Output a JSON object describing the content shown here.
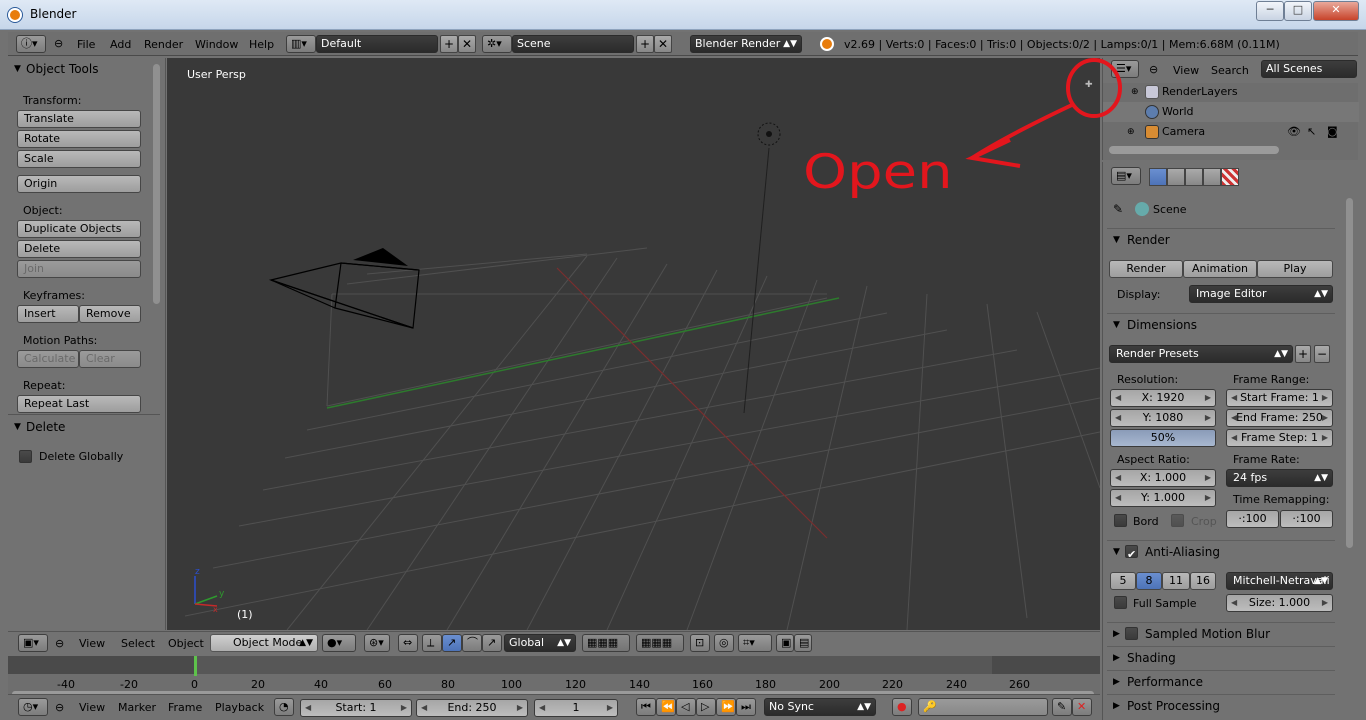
{
  "window": {
    "title": "Blender",
    "min": "─",
    "max": "□",
    "close": "✕"
  },
  "info": {
    "menus": [
      "File",
      "Add",
      "Render",
      "Window",
      "Help"
    ],
    "screen": "Default",
    "scene": "Scene",
    "engine": "Blender Render",
    "stats": "v2.69 | Verts:0 | Faces:0 | Tris:0 | Objects:0/2 | Lamps:0/1 | Mem:6.68M (0.11M)"
  },
  "toolshelf": {
    "title": "Object Tools",
    "transform_label": "Transform:",
    "translate": "Translate",
    "rotate": "Rotate",
    "scale": "Scale",
    "origin": "Origin",
    "object_label": "Object:",
    "duplicate": "Duplicate Objects",
    "delete": "Delete",
    "join": "Join",
    "keyframes_label": "Keyframes:",
    "insert": "Insert",
    "remove": "Remove",
    "motion_label": "Motion Paths:",
    "calculate": "Calculate",
    "clear": "Clear",
    "repeat_label": "Repeat:",
    "repeat_last": "Repeat Last",
    "op_title": "Delete",
    "delete_globally": "Delete Globally"
  },
  "viewport": {
    "label": "User Persp",
    "frame": "(1)"
  },
  "annotation": {
    "text": "Open"
  },
  "view3d_header": {
    "menus": [
      "View",
      "Select",
      "Object"
    ],
    "mode": "Object Mode",
    "orientation": "Global"
  },
  "timeline": {
    "ticks": [
      "-40",
      "-20",
      "0",
      "20",
      "40",
      "60",
      "80",
      "100",
      "120",
      "140",
      "160",
      "180",
      "200",
      "220",
      "240",
      "260"
    ],
    "menus": [
      "View",
      "Marker",
      "Frame",
      "Playback"
    ],
    "start": "Start: 1",
    "end": "End: 250",
    "current": "1",
    "sync": "No Sync"
  },
  "outliner": {
    "menus": [
      "View",
      "Search"
    ],
    "display": "All Scenes",
    "rows": [
      "RenderLayers",
      "World",
      "Camera"
    ]
  },
  "properties": {
    "context": "Scene",
    "render_title": "Render",
    "render_btn": "Render",
    "animation_btn": "Animation",
    "play_btn": "Play",
    "display_label": "Display:",
    "display_value": "Image Editor",
    "dimensions_title": "Dimensions",
    "render_presets": "Render Presets",
    "resolution_label": "Resolution:",
    "res_x": "X: 1920",
    "res_y": "Y: 1080",
    "res_pct": "50%",
    "frame_range_label": "Frame Range:",
    "start_frame": "Start Frame: 1",
    "end_frame": "End Frame: 250",
    "frame_step": "Frame Step: 1",
    "aspect_label": "Aspect Ratio:",
    "asp_x": "X: 1.000",
    "asp_y": "Y: 1.000",
    "frame_rate_label": "Frame Rate:",
    "fps": "24 fps",
    "time_remap_label": "Time Remapping:",
    "remap_old": "·:100",
    "remap_new": "·:100",
    "bord": "Bord",
    "crop": "Crop",
    "aa_title": "Anti-Aliasing",
    "aa_samples": [
      "5",
      "8",
      "11",
      "16"
    ],
    "aa_filter": "Mitchell-Netravali",
    "full_sample": "Full Sample",
    "size": "Size: 1.000",
    "smb_title": "Sampled Motion Blur",
    "shading_title": "Shading",
    "performance_title": "Performance",
    "post_title": "Post Processing"
  }
}
